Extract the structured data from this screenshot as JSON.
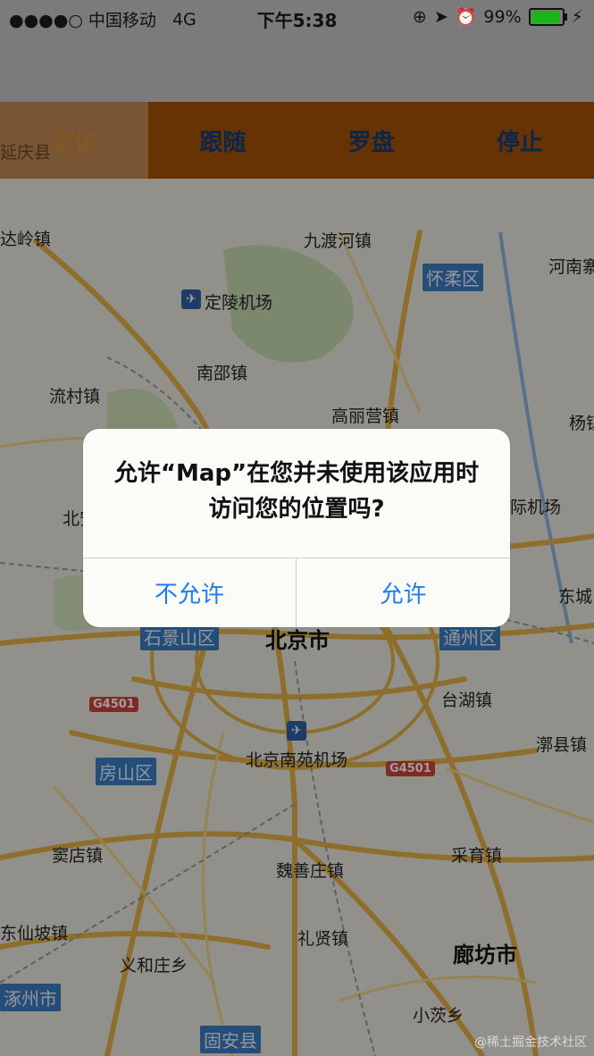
{
  "status_bar": {
    "carrier": "●●●●○ 中国移动",
    "network": "4G",
    "time": "下午5:38",
    "battery": "99%",
    "battery_level": 0.99
  },
  "toolbar": {
    "items": [
      {
        "label": "定位",
        "active": true
      },
      {
        "label": "跟随",
        "active": false
      },
      {
        "label": "罗盘",
        "active": false
      },
      {
        "label": "停止",
        "active": false
      }
    ]
  },
  "map": {
    "labels": {
      "yanqing": "延庆县",
      "badaling": "达岭镇",
      "jiuduhe": "九渡河镇",
      "huairou": "怀柔区",
      "henan": "河南寨",
      "dingling": "定陵机场",
      "nanshao": "南邵镇",
      "liucun": "流村镇",
      "gaoliying": "高丽营镇",
      "yang": "杨镇",
      "bei": "北安",
      "jichang": "际机场",
      "dongcheng": "东城",
      "shijingshan": "石景山区",
      "beijing": "北京市",
      "tongzhou": "通州区",
      "taihu": "台湖镇",
      "g4501a": "G4501",
      "g4501b": "G4501",
      "nanyuan": "北京南苑机场",
      "fangshan": "房山区",
      "yuxian": "漷县镇",
      "doudian": "窦店镇",
      "caiyu": "采育镇",
      "weishanzhuang": "魏善庄镇",
      "dongxianpo": "东仙坡镇",
      "lixian": "礼贤镇",
      "langfang": "廊坊市",
      "yihezhuang": "义和庄乡",
      "zhuozhou": "涿州市",
      "xiaofa": "小茨乡",
      "gu_an": "固安县"
    }
  },
  "alert": {
    "message": "允许“Map”在您并未使用该应用时访问您的位置吗?",
    "deny_label": "不允许",
    "allow_label": "允许"
  },
  "watermark": "@稀土掘金技术社区"
}
